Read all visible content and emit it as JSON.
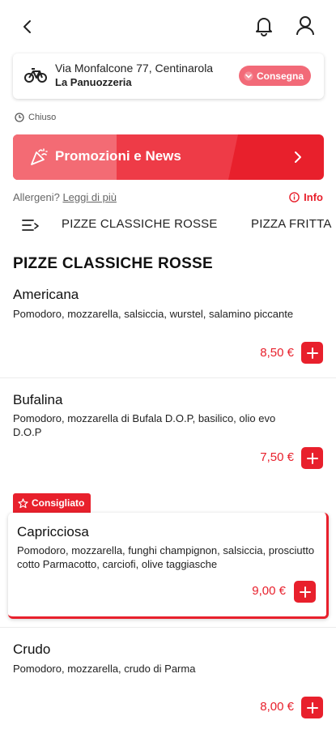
{
  "header": {
    "back_icon": "chevron-left-icon",
    "bell_icon": "bell-icon",
    "user_icon": "user-icon"
  },
  "address": {
    "icon": "bicycle-icon",
    "street": "Via Monfalcone 77, Centinarola",
    "store": "La Panuozzeria",
    "mode_label": "Consegna",
    "mode_icon": "chevron-down-icon"
  },
  "status": {
    "icon": "clock-icon",
    "label": "Chiuso"
  },
  "promo": {
    "label": "Promozioni e News",
    "icon": "party-popper-icon",
    "arrow_icon": "chevron-right-icon"
  },
  "allergens": {
    "question": "Allergeni?",
    "link": "Leggi di più",
    "info_label": "Info",
    "info_icon": "info-icon"
  },
  "categories": {
    "menu_icon": "list-menu-icon",
    "tabs": [
      "PIZZE CLASSICHE ROSSE",
      "PIZZA FRITTA"
    ]
  },
  "section": {
    "title": "PIZZE CLASSICHE ROSSE"
  },
  "items": [
    {
      "name": "Americana",
      "description": "Pomodoro, mozzarella, salsiccia, wurstel, salamino piccante",
      "price": "8,50 €"
    },
    {
      "name": "Bufalina",
      "description": "Pomodoro, mozzarella di Bufala D.O.P, basilico, olio evo D.O.P",
      "price": "7,50 €"
    },
    {
      "name": "Capricciosa",
      "description": "Pomodoro, mozzarella, funghi champignon, salsiccia, prosciutto cotto Parmacotto, carciofi, olive taggiasche",
      "price": "9,00 €",
      "badge": "Consigliato",
      "badge_icon": "star-icon"
    },
    {
      "name": "Crudo",
      "description": "Pomodoro, mozzarella, crudo di Parma",
      "price": "8,00 €"
    }
  ],
  "colors": {
    "accent": "#e8202c",
    "accent_light": "#f36b74"
  }
}
